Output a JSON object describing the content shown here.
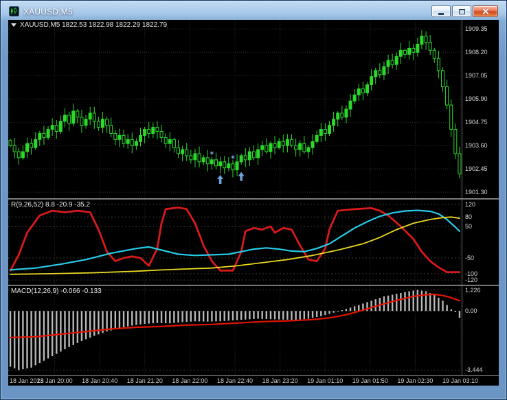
{
  "window": {
    "title": "XAUUSD,M5"
  },
  "colors": {
    "background": "#000000",
    "candle": "#2bd92b",
    "indicator_red": "#d81a1a",
    "indicator_cyan": "#28cbe8",
    "indicator_yellow": "#ead821",
    "macd_histogram": "#b8b8b8",
    "macd_signal": "#e51400",
    "marker_blue": "#6fa3d8",
    "close_button_red": "#d24726"
  },
  "chart_data": {
    "type": "candlestick",
    "symbol": "XAUUSD",
    "timeframe": "M5",
    "main": {
      "label": "XAUUSD,M5  1822.53 1822.98 1822.29 1822.79",
      "y_ticks": [
        "1909.35",
        "1908.20",
        "1907.05",
        "1905.90",
        "1904.75",
        "1903.60",
        "1902.45",
        "1901.30"
      ],
      "ylim": [
        1901.0,
        1909.8
      ],
      "closes": [
        1903.6,
        1903.3,
        1903.0,
        1903.3,
        1903.7,
        1903.5,
        1903.9,
        1904.2,
        1904.0,
        1904.4,
        1904.6,
        1904.3,
        1904.8,
        1905.1,
        1904.7,
        1905.3,
        1905.0,
        1904.6,
        1904.9,
        1905.2,
        1904.8,
        1904.5,
        1904.9,
        1904.6,
        1904.2,
        1903.9,
        1904.1,
        1903.7,
        1903.9,
        1903.6,
        1903.8,
        1904.1,
        1904.4,
        1904.2,
        1904.5,
        1904.3,
        1904.0,
        1903.7,
        1903.9,
        1903.5,
        1903.2,
        1903.4,
        1903.1,
        1902.9,
        1903.2,
        1902.8,
        1903.0,
        1902.7,
        1902.9,
        1902.6,
        1902.8,
        1902.5,
        1902.7,
        1902.4,
        1902.8,
        1903.1,
        1902.9,
        1903.3,
        1903.0,
        1903.4,
        1903.6,
        1903.3,
        1903.7,
        1903.5,
        1903.8,
        1903.6,
        1903.9,
        1903.6,
        1903.4,
        1903.7,
        1903.3,
        1903.5,
        1903.8,
        1904.1,
        1904.4,
        1904.2,
        1904.6,
        1904.9,
        1905.2,
        1905.0,
        1905.4,
        1905.8,
        1906.1,
        1906.4,
        1906.2,
        1906.6,
        1907.0,
        1907.3,
        1907.1,
        1907.5,
        1907.8,
        1907.6,
        1908.0,
        1908.3,
        1908.1,
        1908.4,
        1908.2,
        1908.6,
        1909.0,
        1908.7,
        1908.3,
        1907.9,
        1907.3,
        1906.5,
        1905.6,
        1904.4,
        1903.2,
        1902.2
      ],
      "markers": [
        {
          "shape": "star",
          "bar": 48,
          "price": 1903.1
        },
        {
          "shape": "arrow-up",
          "bar": 50,
          "price": 1902.15
        },
        {
          "shape": "star",
          "bar": 53,
          "price": 1902.9
        },
        {
          "shape": "arrow-up",
          "bar": 55,
          "price": 1902.3
        }
      ]
    },
    "indicator1": {
      "label": "R(9,26,52) 8.8 -20.9 -35.2",
      "y_ticks": [
        120,
        80,
        50,
        -50,
        -100,
        -120
      ],
      "ylim": [
        -135,
        135
      ],
      "series": [
        {
          "name": "red",
          "color": "#d81a1a",
          "points": [
            [
              0,
              -90
            ],
            [
              2,
              -40
            ],
            [
              4,
              30
            ],
            [
              7,
              85
            ],
            [
              10,
              100
            ],
            [
              13,
              95
            ],
            [
              16,
              100
            ],
            [
              19,
              95
            ],
            [
              21,
              40
            ],
            [
              23,
              -30
            ],
            [
              25,
              -60
            ],
            [
              27,
              -50
            ],
            [
              29,
              -45
            ],
            [
              31,
              -50
            ],
            [
              33,
              -75
            ],
            [
              35,
              -20
            ],
            [
              36,
              60
            ],
            [
              37,
              105
            ],
            [
              40,
              110
            ],
            [
              42,
              105
            ],
            [
              44,
              60
            ],
            [
              46,
              -10
            ],
            [
              48,
              -60
            ],
            [
              50,
              -90
            ],
            [
              53,
              -90
            ],
            [
              55,
              -30
            ],
            [
              56,
              35
            ],
            [
              58,
              45
            ],
            [
              60,
              40
            ],
            [
              62,
              50
            ],
            [
              63,
              30
            ],
            [
              65,
              45
            ],
            [
              67,
              40
            ],
            [
              69,
              -10
            ],
            [
              71,
              -55
            ],
            [
              73,
              -60
            ],
            [
              75,
              -20
            ],
            [
              76,
              40
            ],
            [
              78,
              100
            ],
            [
              82,
              105
            ],
            [
              86,
              108
            ],
            [
              88,
              100
            ],
            [
              90,
              85
            ],
            [
              93,
              50
            ],
            [
              96,
              10
            ],
            [
              98,
              -30
            ],
            [
              100,
              -60
            ],
            [
              102,
              -80
            ],
            [
              104,
              -95
            ],
            [
              107,
              -95
            ]
          ]
        },
        {
          "name": "cyan",
          "color": "#28cbe8",
          "points": [
            [
              0,
              -88
            ],
            [
              6,
              -82
            ],
            [
              12,
              -70
            ],
            [
              18,
              -55
            ],
            [
              24,
              -35
            ],
            [
              30,
              -20
            ],
            [
              33,
              -15
            ],
            [
              36,
              -25
            ],
            [
              40,
              -38
            ],
            [
              44,
              -42
            ],
            [
              48,
              -40
            ],
            [
              52,
              -38
            ],
            [
              55,
              -30
            ],
            [
              58,
              -22
            ],
            [
              61,
              -18
            ],
            [
              64,
              -22
            ],
            [
              67,
              -28
            ],
            [
              70,
              -30
            ],
            [
              73,
              -20
            ],
            [
              76,
              -5
            ],
            [
              79,
              20
            ],
            [
              82,
              45
            ],
            [
              85,
              65
            ],
            [
              88,
              82
            ],
            [
              91,
              93
            ],
            [
              94,
              99
            ],
            [
              97,
              101
            ],
            [
              100,
              98
            ],
            [
              102,
              90
            ],
            [
              104,
              72
            ],
            [
              106,
              48
            ],
            [
              107,
              35
            ]
          ]
        },
        {
          "name": "yellow",
          "color": "#ead821",
          "points": [
            [
              0,
              -102
            ],
            [
              10,
              -100
            ],
            [
              20,
              -97
            ],
            [
              30,
              -92
            ],
            [
              36,
              -88
            ],
            [
              42,
              -85
            ],
            [
              48,
              -82
            ],
            [
              54,
              -75
            ],
            [
              60,
              -65
            ],
            [
              66,
              -55
            ],
            [
              72,
              -42
            ],
            [
              78,
              -25
            ],
            [
              84,
              -5
            ],
            [
              88,
              15
            ],
            [
              92,
              40
            ],
            [
              96,
              60
            ],
            [
              100,
              72
            ],
            [
              103,
              78
            ],
            [
              105,
              80
            ],
            [
              107,
              76
            ]
          ]
        }
      ]
    },
    "macd": {
      "label": "MACD(12,26,9) -0.066 -0.133",
      "y_ticks": [
        "1.226",
        "0.00",
        "-3.444"
      ],
      "ylim": [
        -3.75,
        1.45
      ],
      "histogram_anchors": [
        [
          0,
          -3.25
        ],
        [
          2,
          -3.44
        ],
        [
          5,
          -3.3
        ],
        [
          8,
          -2.9
        ],
        [
          11,
          -2.5
        ],
        [
          14,
          -2.1
        ],
        [
          17,
          -1.75
        ],
        [
          20,
          -1.45
        ],
        [
          23,
          -1.2
        ],
        [
          26,
          -1.0
        ],
        [
          29,
          -0.85
        ],
        [
          32,
          -0.75
        ],
        [
          35,
          -0.7
        ],
        [
          38,
          -0.72
        ],
        [
          41,
          -0.65
        ],
        [
          44,
          -0.6
        ],
        [
          47,
          -0.62
        ],
        [
          50,
          -0.6
        ],
        [
          53,
          -0.55
        ],
        [
          56,
          -0.5
        ],
        [
          59,
          -0.45
        ],
        [
          62,
          -0.48
        ],
        [
          65,
          -0.5
        ],
        [
          68,
          -0.52
        ],
        [
          71,
          -0.45
        ],
        [
          74,
          -0.3
        ],
        [
          77,
          -0.1
        ],
        [
          80,
          0.12
        ],
        [
          83,
          0.35
        ],
        [
          86,
          0.6
        ],
        [
          89,
          0.85
        ],
        [
          92,
          1.0
        ],
        [
          95,
          1.15
        ],
        [
          97,
          1.226
        ],
        [
          99,
          1.15
        ],
        [
          101,
          0.95
        ],
        [
          103,
          0.6
        ],
        [
          104,
          0.35
        ],
        [
          105,
          0.1
        ],
        [
          106,
          -0.066
        ],
        [
          107,
          -0.4
        ]
      ],
      "signal_anchors": [
        [
          0,
          -1.55
        ],
        [
          6,
          -1.5
        ],
        [
          12,
          -1.35
        ],
        [
          18,
          -1.2
        ],
        [
          24,
          -1.05
        ],
        [
          30,
          -0.95
        ],
        [
          36,
          -0.9
        ],
        [
          42,
          -0.82
        ],
        [
          48,
          -0.78
        ],
        [
          54,
          -0.7
        ],
        [
          60,
          -0.62
        ],
        [
          66,
          -0.58
        ],
        [
          72,
          -0.5
        ],
        [
          76,
          -0.4
        ],
        [
          80,
          -0.22
        ],
        [
          84,
          0.05
        ],
        [
          88,
          0.35
        ],
        [
          92,
          0.62
        ],
        [
          96,
          0.85
        ],
        [
          99,
          0.95
        ],
        [
          101,
          0.97
        ],
        [
          103,
          0.9
        ],
        [
          105,
          0.78
        ],
        [
          107,
          0.6
        ]
      ]
    },
    "x_labels": [
      "18 Jan 2023",
      "18 Jan 20:00",
      "18 Jan 20:40",
      "18 Jan 21:20",
      "18 Jan 22:00",
      "18 Jan 22:40",
      "18 Jan 23:20",
      "19 Jan 01:10",
      "19 Jan 01:50",
      "19 Jan 02:30",
      "19 Jan 03:10"
    ]
  }
}
